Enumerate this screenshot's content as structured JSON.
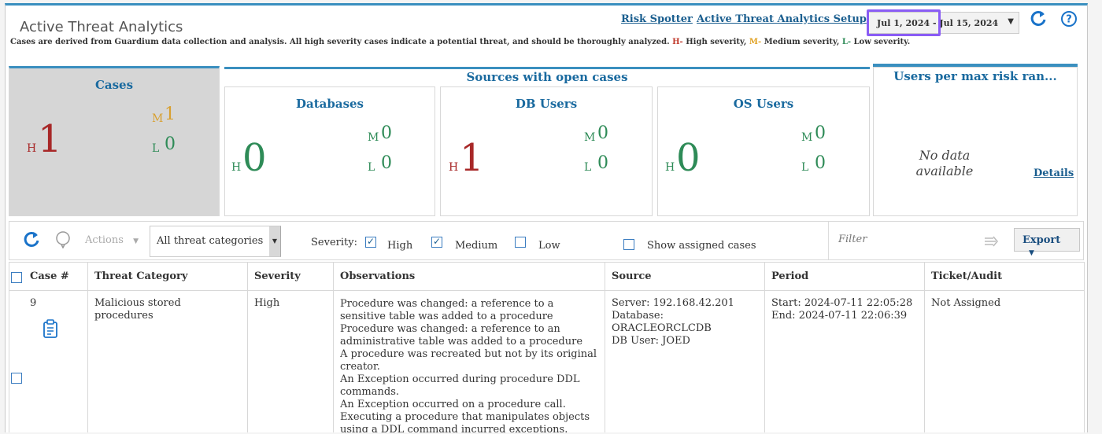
{
  "header": {
    "title": "Active Threat Analytics",
    "description_main": "Cases are derived from Guardium data collection and analysis. All high severity cases indicate a potential threat, and should be thoroughly analyzed.",
    "sev_h": "H-",
    "sev_h_text": "High severity,",
    "sev_m": "M-",
    "sev_m_text": "Medium severity,",
    "sev_l": "L-",
    "sev_l_text": "Low severity.",
    "link_risk_spotter": "Risk Spotter",
    "link_setup": "Active Threat Analytics Setup",
    "date_range": "Jul 1, 2024 - Jul 15, 2024"
  },
  "summary": {
    "cases": {
      "title": "Cases",
      "h_label": "H",
      "h_value": "1",
      "m_label": "M",
      "m_value": "1",
      "l_label": "L",
      "l_value": "0"
    },
    "sources_title": "Sources with open cases",
    "databases": {
      "title": "Databases",
      "h_label": "H",
      "h_value": "0",
      "m_label": "M",
      "m_value": "0",
      "l_label": "L",
      "l_value": "0"
    },
    "db_users": {
      "title": "DB Users",
      "h_label": "H",
      "h_value": "1",
      "m_label": "M",
      "m_value": "0",
      "l_label": "L",
      "l_value": "0"
    },
    "os_users": {
      "title": "OS Users",
      "h_label": "H",
      "h_value": "0",
      "m_label": "M",
      "m_value": "0",
      "l_label": "L",
      "l_value": "0"
    },
    "users_risk": {
      "title": "Users per max risk ran...",
      "no_data": "No data available",
      "details": "Details"
    }
  },
  "toolbar": {
    "actions_label": "Actions",
    "category_select": "All threat categories",
    "severity_label": "Severity:",
    "high_label": "High",
    "high_checked": true,
    "medium_label": "Medium",
    "medium_checked": true,
    "low_label": "Low",
    "low_checked": false,
    "show_assigned_label": "Show assigned cases",
    "filter_placeholder": "Filter",
    "export_label": "Export"
  },
  "table": {
    "columns": [
      "Case #",
      "Threat Category",
      "Severity",
      "Observations",
      "Source",
      "Period",
      "Ticket/Audit"
    ],
    "rows": [
      {
        "case": "9",
        "category": "Malicious stored procedures",
        "severity": "High",
        "observations": "Procedure was changed: a reference to a sensitive table was added to a procedure\nProcedure was changed: a reference to an administrative table was added to a procedure\nA procedure was recreated but not by its original creator.\nAn Exception occurred during procedure DDL commands.\nAn Exception occurred on a procedure call.\nExecuting a procedure that manipulates objects using a DDL command incurred exceptions.",
        "source": "Server: 192.168.42.201\nDatabase: ORACLEORCLCDB\nDB User: JOED",
        "period": "Start: 2024-07-11 22:05:28\nEnd: 2024-07-11 22:06:39",
        "ticket": "Not Assigned"
      }
    ]
  },
  "colors": {
    "accent": "#3a8fbf",
    "high": "#a82828",
    "medium": "#d8a030",
    "low": "#2e8b57",
    "highlight": "#8a5cf5"
  }
}
